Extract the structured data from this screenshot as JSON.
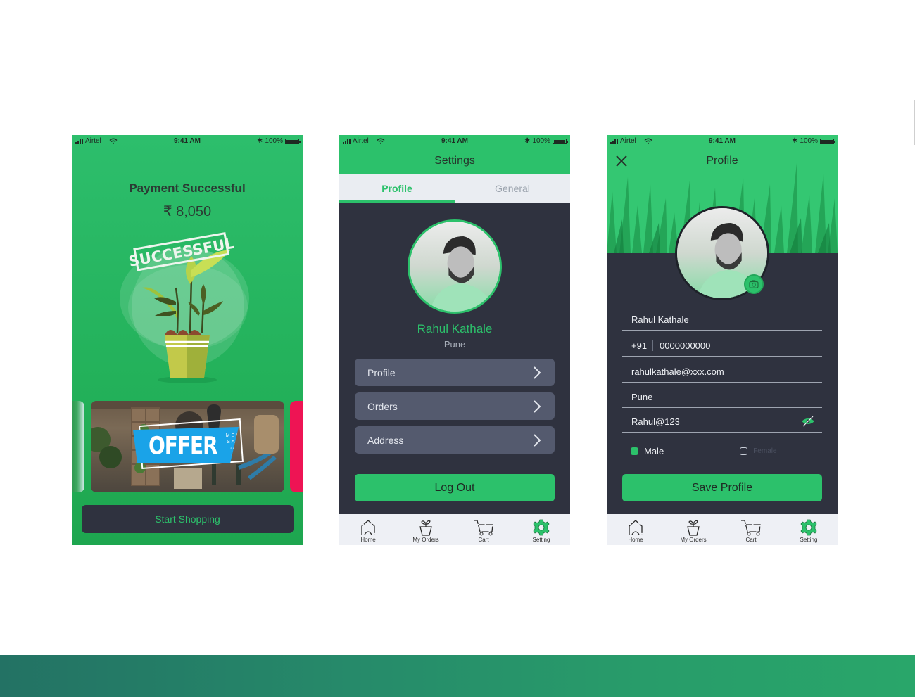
{
  "status_bar": {
    "carrier": "Airtel",
    "time": "9:41 AM",
    "battery": "100%"
  },
  "payment_screen": {
    "title": "Payment Successful",
    "amount": "₹ 8,050",
    "stamp_text": "SUCCESSFUL",
    "banner": {
      "headline": "OFFER",
      "sub_line1": "MEGA",
      "sub_line2": "SALE",
      "sub_line3": "SHOP NOW"
    },
    "cta_label": "Start Shopping"
  },
  "settings_screen": {
    "title": "Settings",
    "tabs": [
      {
        "label": "Profile",
        "active": true
      },
      {
        "label": "General",
        "active": false
      }
    ],
    "user": {
      "name": "Rahul Kathale",
      "city": "Pune"
    },
    "menu": [
      {
        "label": "Profile"
      },
      {
        "label": "Orders"
      },
      {
        "label": "Address"
      }
    ],
    "logout_label": "Log Out"
  },
  "profile_screen": {
    "title": "Profile",
    "fields": {
      "name": "Rahul Kathale",
      "country_code": "+91",
      "phone": "0000000000",
      "email": "rahulkathale@xxx.com",
      "city": "Pune",
      "password": "Rahul@123"
    },
    "gender_options": [
      {
        "label": "Male",
        "selected": true
      },
      {
        "label": "Female",
        "selected": false
      }
    ],
    "save_label": "Save Profile"
  },
  "tab_bar": {
    "items": [
      {
        "label": "Home",
        "icon": "home-icon",
        "active": false
      },
      {
        "label": "My Orders",
        "icon": "plant-pot-icon",
        "active": false
      },
      {
        "label": "Cart",
        "icon": "cart-icon",
        "active": false
      },
      {
        "label": "Setting",
        "icon": "gear-icon",
        "active": true
      }
    ]
  },
  "colors": {
    "brand_green": "#2cc16b",
    "dark_surface": "#2f323f",
    "menu_item": "#545a6e",
    "offer_blue": "#1aa3e8",
    "peek_red": "#ee1454"
  }
}
